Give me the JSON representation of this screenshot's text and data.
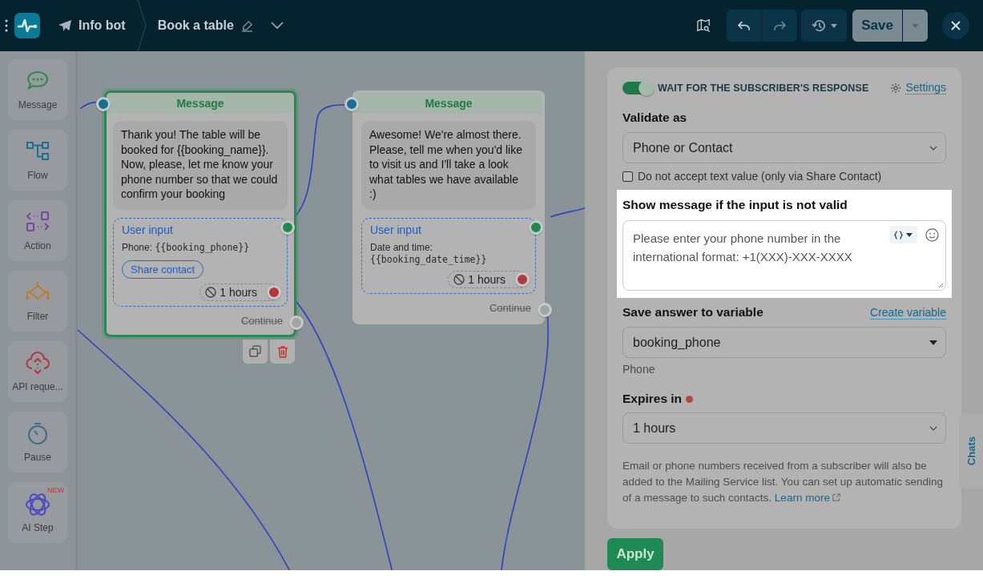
{
  "topbar": {
    "bot_name": "Info bot",
    "flow_name": "Book a table",
    "save_label": "Save"
  },
  "toolbox": [
    {
      "kind": "message",
      "label": "Message"
    },
    {
      "kind": "flow",
      "label": "Flow"
    },
    {
      "kind": "action",
      "label": "Action"
    },
    {
      "kind": "filter",
      "label": "Filter"
    },
    {
      "kind": "api",
      "label": "API reque..."
    },
    {
      "kind": "pause",
      "label": "Pause"
    },
    {
      "kind": "ai",
      "label": "AI Step",
      "badge": "NEW"
    }
  ],
  "canvas": {
    "nodes": [
      {
        "title": "Message",
        "selected": true,
        "text": "Thank you! The table will be booked for {{booking_name}}. Now, please, let me know your phone number so that we could confirm your booking",
        "input": {
          "label": "User input",
          "variable_label": "Phone:",
          "variable": "{{booking_phone}}",
          "button": "Share contact",
          "timeout": "1 hours"
        },
        "continue": {
          "label": "Continue",
          "disabled": true
        }
      },
      {
        "title": "Message",
        "selected": false,
        "text": "Awesome! We're almost there. Please, tell me when you'd like to visit us and I'll take a look what tables we have available :)",
        "input": {
          "label": "User input",
          "variable_label": "Date and time:",
          "variable": "{{booking_date_time}}",
          "timeout": "1 hours"
        },
        "continue": {
          "label": "Continue",
          "disabled": true
        }
      }
    ]
  },
  "panel": {
    "wait_toggle": {
      "label": "WAIT FOR THE SUBSCRIBER'S RESPONSE",
      "on": true
    },
    "settings_link": "Settings",
    "validate_label": "Validate as",
    "validate_value": "Phone or Contact",
    "text_checkbox": {
      "label": "Do not accept text value (only via Share Contact)",
      "checked": false
    },
    "invalid_message": {
      "label": "Show message if the input is not valid",
      "value": "Please enter your phone number in the international format: +1(XXX)-XXX-XXXX"
    },
    "variable_label": "Save answer to variable",
    "create_variable": "Create variable",
    "variable_value": "booking_phone",
    "variable_type": "Phone",
    "expires_label": "Expires in",
    "expires_value": "1 hours",
    "note": "Email or phone numbers received from a subscriber will also be added to the Mailing Service list. You can set up automatic sending of a message to such contacts.",
    "learn_more": "Learn more"
  },
  "apply_label": "Apply",
  "chats_tab": "Chats"
}
